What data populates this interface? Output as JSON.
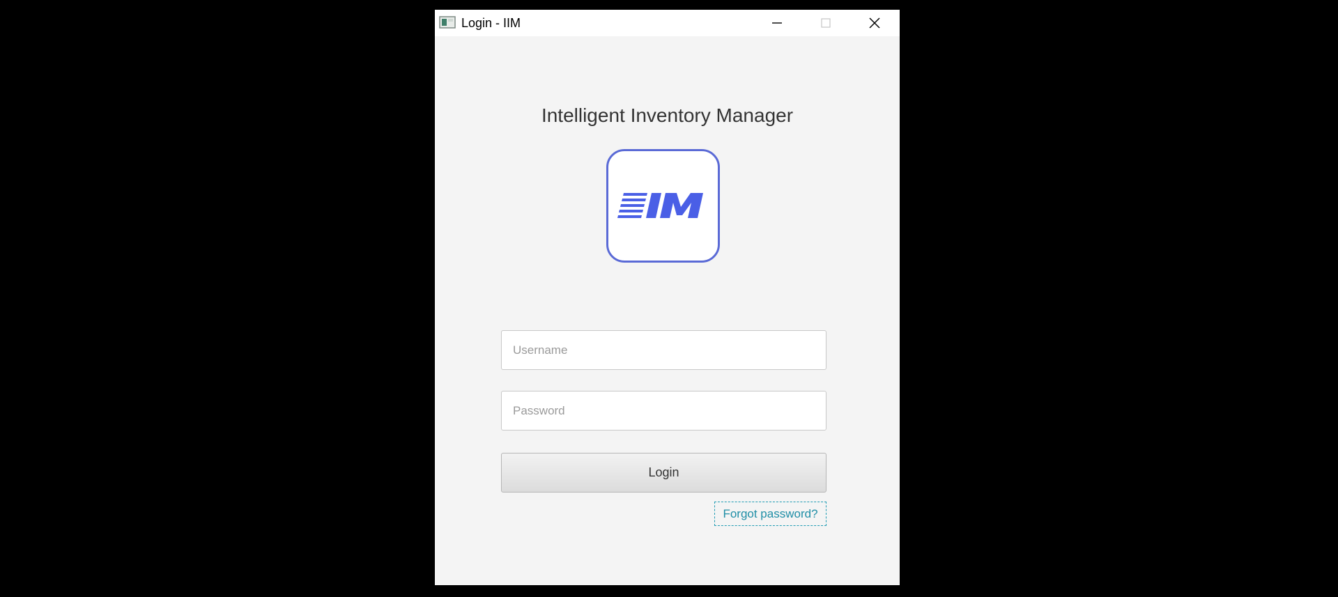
{
  "window": {
    "title": "Login - IIM",
    "controls": {
      "minimize_icon": "minimize-icon",
      "maximize_icon": "maximize-icon",
      "close_icon": "close-icon"
    }
  },
  "main": {
    "heading": "Intelligent Inventory Manager",
    "logo": {
      "text": "IIM",
      "color": "#4a5fe6",
      "border_color": "#5a6ad6"
    },
    "username": {
      "placeholder": "Username",
      "value": ""
    },
    "password": {
      "placeholder": "Password",
      "value": ""
    },
    "login_label": "Login",
    "forgot_label": "Forgot password?"
  }
}
